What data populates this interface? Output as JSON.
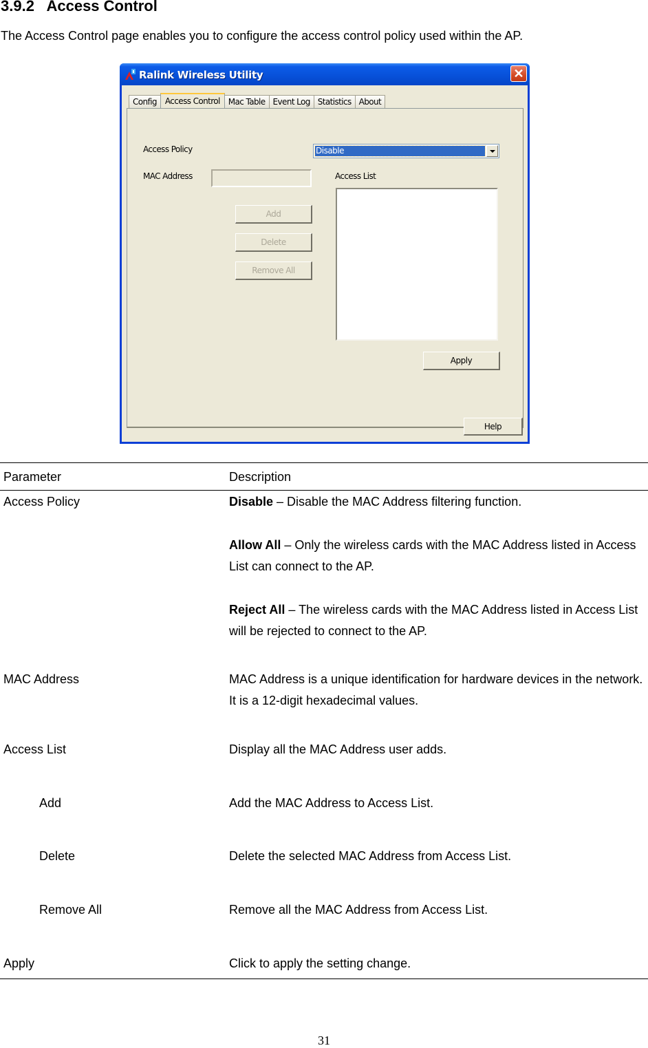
{
  "section": {
    "number": "3.9.2",
    "title": "Access Control",
    "intro": "The Access Control page enables you to configure the access control policy used within the AP."
  },
  "window": {
    "title": "Ralink Wireless Utility",
    "app_icon": "ralink-logo-icon",
    "close_icon": "close-icon",
    "tabs": [
      {
        "label": "Config",
        "active": false
      },
      {
        "label": "Access Control",
        "active": true
      },
      {
        "label": "Mac Table",
        "active": false
      },
      {
        "label": "Event Log",
        "active": false
      },
      {
        "label": "Statistics",
        "active": false
      },
      {
        "label": "About",
        "active": false
      }
    ],
    "access_policy": {
      "label": "Access Policy",
      "selected": "Disable"
    },
    "mac_address": {
      "label": "MAC Address",
      "value": ""
    },
    "access_list": {
      "label": "Access List",
      "items": []
    },
    "buttons": {
      "add": "Add",
      "delete": "Delete",
      "remove_all": "Remove All",
      "apply": "Apply",
      "help": "Help"
    },
    "colors": {
      "title_bar": "#0750d8",
      "client_bg": "#ece9d8",
      "selection": "#316ac5",
      "close_button": "#d44a25"
    }
  },
  "table": {
    "headers": {
      "parameter": "Parameter",
      "description": "Description"
    },
    "rows": [
      {
        "parameter": "Access Policy",
        "items": [
          {
            "term": "Disable",
            "text": " – Disable the MAC Address filtering function."
          },
          {
            "term": "Allow All",
            "text": " – Only the wireless cards with the MAC Address listed in Access List can connect to the AP."
          },
          {
            "term": "Reject All",
            "text": " – The wireless cards with the MAC Address listed in Access List will be rejected to connect to the AP."
          }
        ]
      },
      {
        "parameter": "MAC Address",
        "description": "MAC Address is a unique identification for hardware devices in the network. It is a 12-digit hexadecimal values."
      },
      {
        "parameter": "Access List",
        "description": "Display all the MAC Address user adds."
      },
      {
        "parameter": "Add",
        "description": "Add the MAC Address to Access List."
      },
      {
        "parameter": "Delete",
        "description": "Delete the selected MAC Address from Access List."
      },
      {
        "parameter": "Remove All",
        "description": "Remove all the MAC Address from Access List."
      },
      {
        "parameter": "Apply",
        "description": "Click to apply the setting change."
      }
    ]
  },
  "page_number": "31"
}
